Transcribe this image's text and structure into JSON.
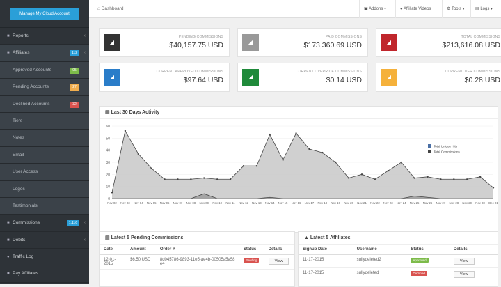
{
  "sidebar": {
    "cloud_button": "Manage My Cloud Account",
    "items": [
      {
        "label": "Reports",
        "icon": "■",
        "chev": "‹"
      },
      {
        "label": "Affiliates",
        "icon": "■",
        "badge": "112",
        "badge_color": "#2a9fd8",
        "active": true
      },
      {
        "label": "Approved Accounts",
        "badge": "95",
        "badge_color": "#7dbb4a",
        "sub": true
      },
      {
        "label": "Pending Accounts",
        "badge": "27",
        "badge_color": "#f0ad4e",
        "sub": true
      },
      {
        "label": "Declined Accounts",
        "badge": "32",
        "badge_color": "#d9534f",
        "sub": true
      },
      {
        "label": "Tiers",
        "sub": true
      },
      {
        "label": "Notes",
        "sub": true
      },
      {
        "label": "Email",
        "sub": true
      },
      {
        "label": "User Access",
        "sub": true
      },
      {
        "label": "Logos",
        "sub": true
      },
      {
        "label": "Testimonials",
        "sub": true
      },
      {
        "label": "Commissions",
        "icon": "■",
        "badge": "1,116",
        "badge_color": "#2a9fd8",
        "chev": "‹"
      },
      {
        "label": "Debits",
        "icon": "■",
        "chev": "‹"
      },
      {
        "label": "Traffic Log",
        "icon": "●"
      },
      {
        "label": "Pay Affiliates",
        "icon": "■"
      }
    ]
  },
  "topbar": {
    "breadcrumb": "Dashboard",
    "menus": [
      "Addons",
      "Affiliate Videos",
      "Tools",
      "Logs"
    ]
  },
  "stats": [
    {
      "label": "Pending Commissions",
      "value": "$40,157.75 USD",
      "color": "#333333"
    },
    {
      "label": "Paid Commissions",
      "value": "$173,360.69 USD",
      "color": "#999999"
    },
    {
      "label": "Total Commissions",
      "value": "$213,616.08 USD",
      "color": "#c0262c"
    },
    {
      "label": "Current Approved Commissions",
      "value": "$97.64 USD",
      "color": "#2a7dc9"
    },
    {
      "label": "Current Override Commissions",
      "value": "$0.14 USD",
      "color": "#1f8a3a"
    },
    {
      "label": "Current Tier Commissions",
      "value": "$0.28 USD",
      "color": "#f5b13b"
    }
  ],
  "activity": {
    "title": "Last 30 Days Activity"
  },
  "chart_data": {
    "type": "area",
    "title": "Last 30 Days Activity",
    "ylim": [
      0,
      60
    ],
    "yticks": [
      0,
      10,
      20,
      30,
      40,
      50,
      60
    ],
    "categories": [
      "Nov 02",
      "Nov 03",
      "Nov 04",
      "Nov 05",
      "Nov 06",
      "Nov 07",
      "Nov 08",
      "Nov 09",
      "Nov 10",
      "Nov 11",
      "Nov 12",
      "Nov 13",
      "Nov 14",
      "Nov 15",
      "Nov 16",
      "Nov 17",
      "Nov 18",
      "Nov 19",
      "Nov 20",
      "Nov 21",
      "Nov 22",
      "Nov 23",
      "Nov 24",
      "Nov 25",
      "Nov 26",
      "Nov 27",
      "Nov 28",
      "Nov 29",
      "Nov 30",
      "Dec 01"
    ],
    "legend_position": "top-right",
    "series": [
      {
        "name": "Total Unique Hits",
        "color": "#4a6fa5",
        "values": [
          5,
          56,
          37,
          25,
          16,
          16,
          16,
          17,
          16,
          16,
          27,
          27,
          53,
          32,
          54,
          41,
          38,
          30,
          17,
          20,
          16,
          23,
          30,
          17,
          18,
          16,
          16,
          16,
          18,
          9
        ]
      },
      {
        "name": "Total Commissions",
        "color": "#444444",
        "values": [
          0,
          0,
          0,
          0,
          0,
          0,
          0,
          4,
          0,
          0,
          0,
          0,
          1,
          0,
          0,
          0,
          0,
          0,
          0,
          0,
          0,
          0,
          0,
          2,
          1,
          0,
          0,
          0,
          0,
          0
        ]
      }
    ]
  },
  "pending": {
    "title": "Latest 5 Pending Commissions",
    "headers": [
      "Date",
      "Amount",
      "Order #",
      "Status",
      "Details"
    ],
    "rows": [
      {
        "date": "12-01-2015",
        "amount": "$6.50 USD",
        "order": "8d045786-9893-11e5-ae4b-00505a5a58e4",
        "status": "Pending",
        "details": "View"
      }
    ]
  },
  "affiliates": {
    "title": "Latest 5 Affiliates",
    "headers": [
      "Signup Date",
      "Username",
      "Status",
      "Details"
    ],
    "rows": [
      {
        "date": "11-17-2015",
        "username": "sullydeleted2",
        "status": "Approved",
        "status_color": "#7dbb4a",
        "details": "View"
      },
      {
        "date": "11-17-2015",
        "username": "sullydeleted",
        "status": "Declined",
        "status_color": "#d9534f",
        "details": "View"
      }
    ]
  }
}
